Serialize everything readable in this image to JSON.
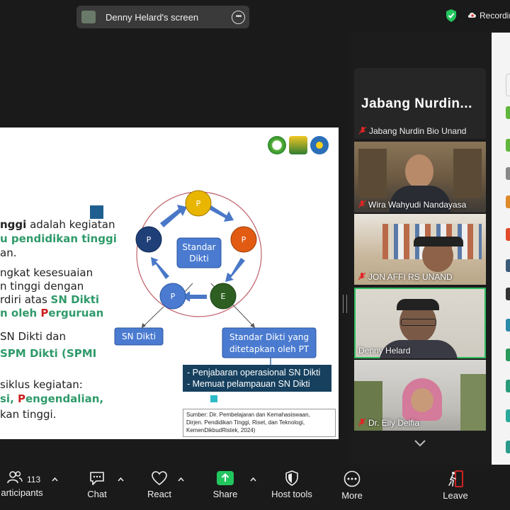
{
  "top_bar": {
    "share_label": "Denny Helard's screen",
    "recording_label": "Recordin",
    "colors": {
      "shield": "#22c55e",
      "record": "#e5e5e5"
    }
  },
  "slide": {
    "lines": [
      {
        "parts": [
          {
            "t": "nggi",
            "s": "bold"
          },
          {
            "t": " adalah kegiatan",
            "s": ""
          }
        ]
      },
      {
        "parts": [
          {
            "t": "u pendidikan tinggi",
            "s": "green"
          }
        ]
      },
      {
        "parts": [
          {
            "t": "an.",
            "s": ""
          }
        ]
      },
      {
        "parts": [
          {
            "t": "ngkat kesesuaian",
            "s": ""
          }
        ]
      },
      {
        "parts": [
          {
            "t": "n tinggi dengan",
            "s": ""
          }
        ]
      },
      {
        "parts": [
          {
            "t": "rdiri atas ",
            "s": ""
          },
          {
            "t": "SN Dikti",
            "s": "green"
          }
        ]
      },
      {
        "parts": [
          {
            "t": "n oleh ",
            "s": "green"
          },
          {
            "t": "P",
            "s": "red"
          },
          {
            "t": "erguruan",
            "s": "green"
          }
        ]
      },
      {
        "parts": [
          {
            "t": " SN Dikti dan",
            "s": ""
          }
        ]
      },
      {
        "parts": [
          {
            "t": "SPM Dikti (SPMI",
            "s": "green"
          }
        ]
      },
      {
        "parts": [
          {
            "t": "siklus kegiatan:",
            "s": ""
          }
        ]
      },
      {
        "parts": [
          {
            "t": "si, ",
            "s": "green"
          },
          {
            "t": "P",
            "s": "red"
          },
          {
            "t": "engendalian,",
            "s": "green"
          }
        ]
      },
      {
        "parts": [
          {
            "t": "kan tinggi.",
            "s": ""
          }
        ]
      }
    ],
    "diagram": {
      "center_line1": "Standar",
      "center_line2": "Dikti",
      "p_label": "P",
      "e_label": "E",
      "sn_dikti": "SN Dikti",
      "pt_line1": "Standar Dikti yang",
      "pt_line2": "ditetapkan oleh PT"
    },
    "darkbox_line1": "- Penjabaran operasional SN Dikti",
    "darkbox_line2": "- Memuat pelampauan SN Dikti",
    "source_line1": "Sumber: Dir. Pembelajaran dan Kemahasiswaan,",
    "source_line2": "Dirjen. Pendidikan Tinggi, Riset, dan Teknologi,",
    "source_line3": "KemenDikbudRistek, 2024)",
    "colors": {
      "green_text": "#2f9a6a",
      "red_text": "#cc1f1f",
      "dark_box": "#16405e"
    }
  },
  "gallery": {
    "header_name": "Jabang  Nurdin...",
    "tiles": [
      {
        "name": "Jabang Nurdin Bio Unand",
        "muted": true
      },
      {
        "name": "Wira Wahyudi Nandayasa",
        "muted": true
      },
      {
        "name": "JON AFFI RS UNAND",
        "muted": true
      },
      {
        "name": "Denny Helard",
        "muted": false
      },
      {
        "name": "Dr. Elly Delfia",
        "muted": true
      }
    ],
    "active_color": "#2fbf5f"
  },
  "toolbar": {
    "participants_label": "articipants",
    "participants_count": "113",
    "chat_label": "Chat",
    "react_label": "React",
    "share_label": "Share",
    "host_tools_label": "Host tools",
    "more_label": "More",
    "leave_label": "Leave",
    "colors": {
      "share": "#22c55e",
      "leave": "#e02424"
    }
  }
}
